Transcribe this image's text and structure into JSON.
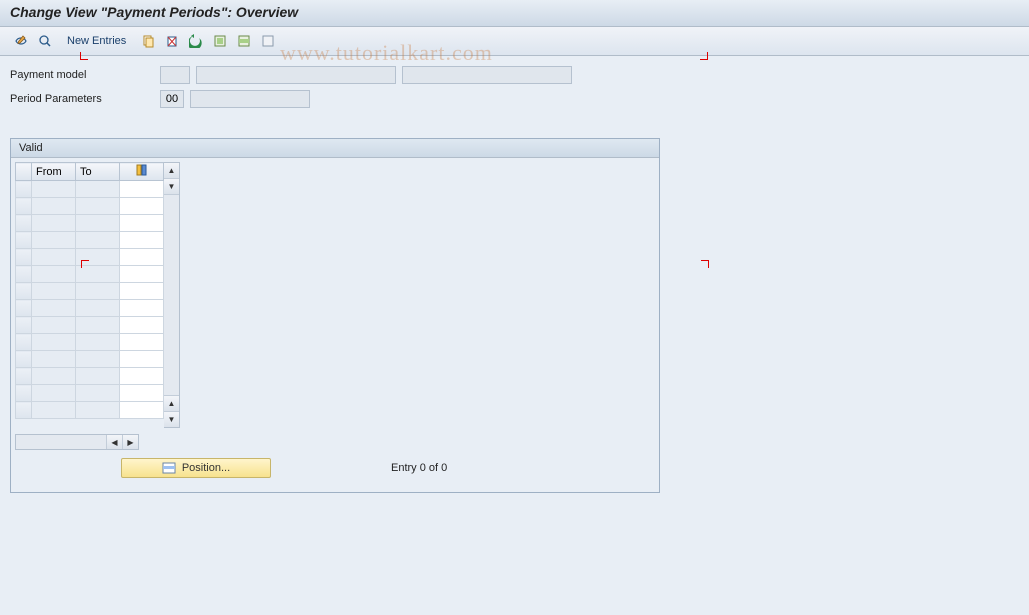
{
  "title": "Change View \"Payment Periods\": Overview",
  "watermark": "www.tutorialkart.com",
  "toolbar": {
    "new_entries": "New Entries"
  },
  "form": {
    "payment_model_label": "Payment model",
    "payment_model_code": "",
    "payment_model_desc": "",
    "payment_model_extra": "",
    "period_params_label": "Period Parameters",
    "period_params_code": "00",
    "period_params_desc": ""
  },
  "panel": {
    "title": "Valid",
    "col_from": "From",
    "col_to": "To",
    "position_label": "Position...",
    "entry_status": "Entry 0 of 0"
  }
}
